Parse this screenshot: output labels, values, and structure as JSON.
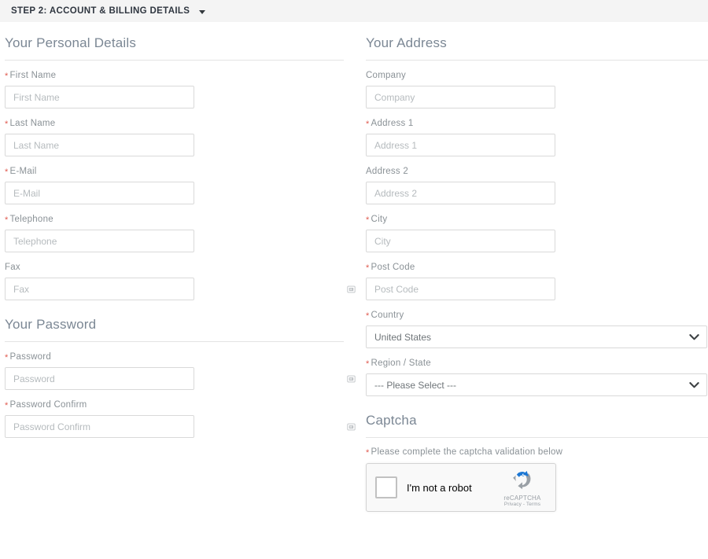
{
  "step_header": {
    "title": "STEP 2: ACCOUNT & BILLING DETAILS",
    "caret_icon": "chevron-down-icon"
  },
  "personal_details": {
    "heading": "Your Personal Details",
    "fields": [
      {
        "label": "First Name",
        "placeholder": "First Name",
        "required": true,
        "icon": ""
      },
      {
        "label": "Last Name",
        "placeholder": "Last Name",
        "required": true,
        "icon": ""
      },
      {
        "label": "E-Mail",
        "placeholder": "E-Mail",
        "required": true,
        "icon": ""
      },
      {
        "label": "Telephone",
        "placeholder": "Telephone",
        "required": true,
        "icon": ""
      },
      {
        "label": "Fax",
        "placeholder": "Fax",
        "required": false,
        "icon": "password-manager-icon"
      }
    ]
  },
  "password_section": {
    "heading": "Your Password",
    "fields": [
      {
        "label": "Password",
        "placeholder": "Password",
        "required": true,
        "icon": "password-manager-icon"
      },
      {
        "label": "Password Confirm",
        "placeholder": "Password Confirm",
        "required": true,
        "icon": "password-manager-icon"
      }
    ]
  },
  "address": {
    "heading": "Your Address",
    "fields": [
      {
        "label": "Company",
        "placeholder": "Company",
        "required": false
      },
      {
        "label": "Address 1",
        "placeholder": "Address 1",
        "required": true
      },
      {
        "label": "Address 2",
        "placeholder": "Address 2",
        "required": false
      },
      {
        "label": "City",
        "placeholder": "City",
        "required": true
      },
      {
        "label": "Post Code",
        "placeholder": "Post Code",
        "required": true
      }
    ],
    "country": {
      "label": "Country",
      "required": true,
      "selected": "United States",
      "options": [
        "United States"
      ]
    },
    "region": {
      "label": "Region / State",
      "required": true,
      "selected": "--- Please Select ---",
      "options": [
        "--- Please Select ---"
      ]
    }
  },
  "captcha": {
    "heading": "Captcha",
    "note": "Please complete the captcha validation below",
    "required": true,
    "widget": {
      "checkbox_label": "I'm not a robot",
      "brand_name": "reCAPTCHA",
      "links": "Privacy - Terms",
      "logo_icon": "recaptcha-logo-icon"
    }
  },
  "colors": {
    "header_bg": "#f4f4f4",
    "header_text": "#2f3640",
    "heading_text": "#7b8794",
    "label_text": "#8a9196",
    "required_asterisk": "#e05a4f",
    "input_border": "#d9d9d9",
    "placeholder": "#b6bbbe",
    "rule": "#e4e4e4",
    "recaptcha_bg": "#f9f9f9",
    "recaptcha_blue": "#1c77d4",
    "recaptcha_gray": "#9aa0a6"
  }
}
